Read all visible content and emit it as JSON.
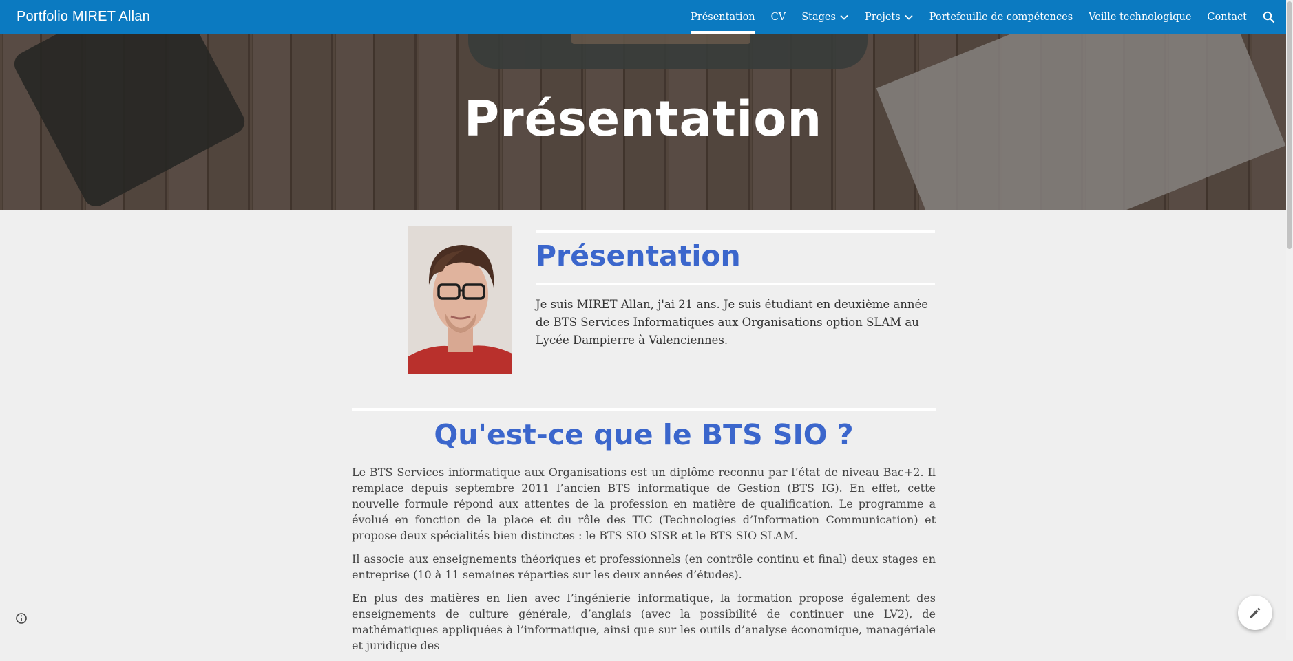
{
  "site": {
    "title": "Portfolio MIRET Allan"
  },
  "nav": {
    "items": [
      {
        "label": "Présentation",
        "active": true,
        "dropdown": false
      },
      {
        "label": "CV",
        "active": false,
        "dropdown": false
      },
      {
        "label": "Stages",
        "active": false,
        "dropdown": true
      },
      {
        "label": "Projets",
        "active": false,
        "dropdown": true
      },
      {
        "label": "Portefeuille de compétences",
        "active": false,
        "dropdown": false
      },
      {
        "label": "Veille technologique",
        "active": false,
        "dropdown": false
      },
      {
        "label": "Contact",
        "active": false,
        "dropdown": false
      }
    ],
    "search_icon": "search-icon"
  },
  "hero": {
    "title": "Présentation"
  },
  "presentation": {
    "heading": "Présentation",
    "text": "Je suis MIRET Allan, j'ai 21 ans. Je suis étudiant en deuxième année de BTS Services Informatiques aux Organisations option SLAM au Lycée Dampierre à Valenciennes."
  },
  "bts": {
    "heading": "Qu'est-ce que le BTS SIO ?",
    "paragraphs": [
      "Le BTS Services informatique aux Organisations est un diplôme reconnu par l’état de niveau Bac+2. Il remplace depuis septembre 2011 l’ancien BTS informatique de Gestion (BTS IG). En effet, cette nouvelle formule répond aux attentes de la profession en matière de qualification. Le programme a évolué en fonction de la place et du rôle des TIC (Technologies d’Information Communication) et propose deux spécialités bien distinctes : le BTS SIO SISR et le BTS SIO SLAM.",
      "Il associe aux enseignements théoriques et professionnels (en contrôle continu et final) deux stages en entreprise (10 à 11 semaines réparties sur les deux années d’études).",
      "En plus des matières en lien avec l’ingénierie informatique, la formation propose également des enseignements de culture générale, d’anglais (avec la possibilité de continuer une LV2), de mathématiques appliquées à l’informatique, ainsi que sur les outils d’analyse économique, managériale et juridique des"
    ]
  },
  "colors": {
    "nav_bg": "#0b7ac1",
    "heading": "#3b66cc",
    "page_bg": "#efefef"
  }
}
